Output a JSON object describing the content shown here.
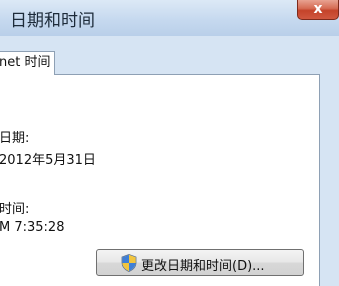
{
  "window": {
    "title": "日期和时间",
    "close_label": "x"
  },
  "tab": {
    "label": "net 时间"
  },
  "content": {
    "date_label": "日期:",
    "date_value": "2012年5月31日",
    "time_label": "时间:",
    "time_value": "M 7:35:28"
  },
  "buttons": {
    "change_datetime": "更改日期和时间(D)...",
    "shield_icon": "uac-shield-icon"
  }
}
